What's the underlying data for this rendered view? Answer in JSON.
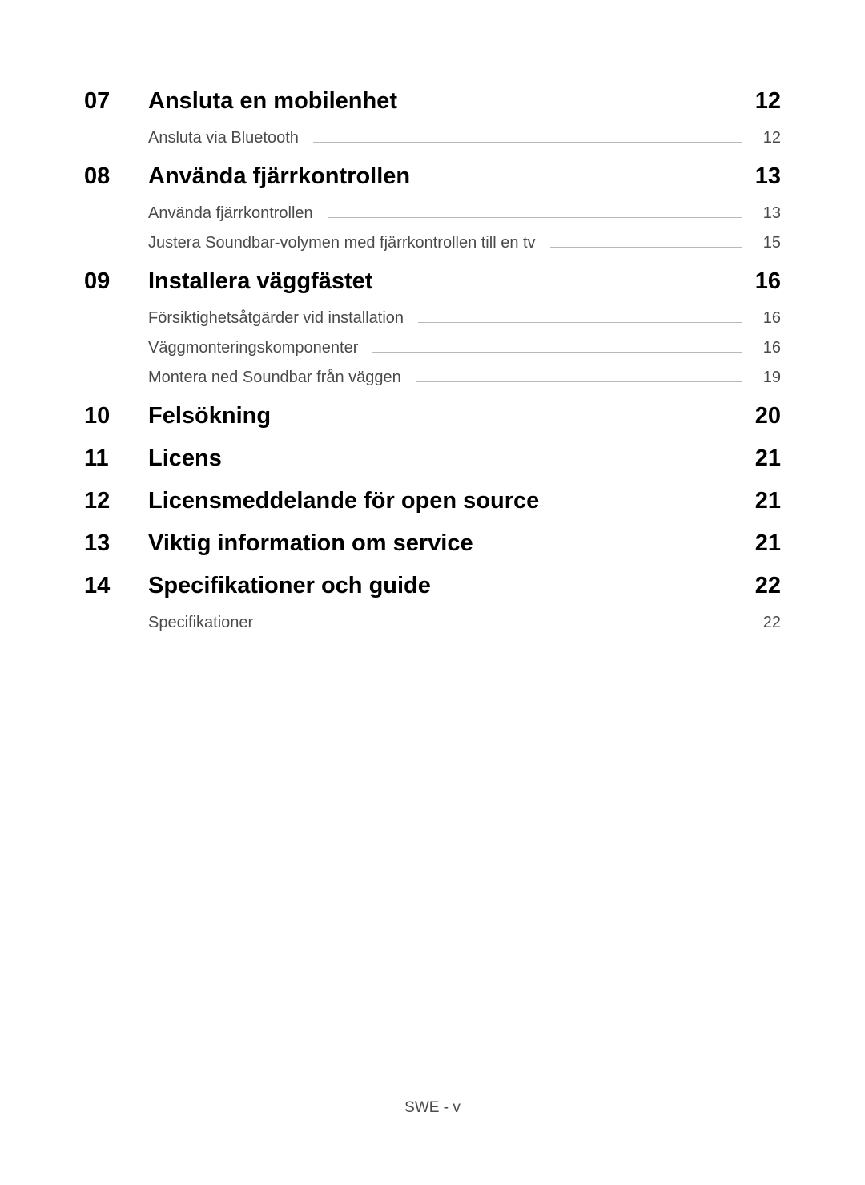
{
  "toc": [
    {
      "number": "07",
      "title": "Ansluta en mobilenhet",
      "page": "12",
      "subitems": [
        {
          "title": "Ansluta via Bluetooth",
          "page": "12"
        }
      ]
    },
    {
      "number": "08",
      "title": "Använda fjärrkontrollen",
      "page": "13",
      "subitems": [
        {
          "title": "Använda fjärrkontrollen",
          "page": "13"
        },
        {
          "title": "Justera Soundbar-volymen med fjärrkontrollen till en tv",
          "page": "15"
        }
      ]
    },
    {
      "number": "09",
      "title": "Installera väggfästet",
      "page": "16",
      "subitems": [
        {
          "title": "Försiktighetsåtgärder vid installation",
          "page": "16"
        },
        {
          "title": "Väggmonteringskomponenter",
          "page": "16"
        },
        {
          "title": "Montera ned Soundbar från väggen",
          "page": "19"
        }
      ]
    },
    {
      "number": "10",
      "title": "Felsökning",
      "page": "20",
      "subitems": []
    },
    {
      "number": "11",
      "title": "Licens",
      "page": "21",
      "subitems": []
    },
    {
      "number": "12",
      "title": "Licensmeddelande för open source",
      "page": "21",
      "subitems": []
    },
    {
      "number": "13",
      "title": "Viktig information om service",
      "page": "21",
      "subitems": []
    },
    {
      "number": "14",
      "title": "Specifikationer och guide",
      "page": "22",
      "subitems": [
        {
          "title": "Specifikationer",
          "page": "22"
        }
      ]
    }
  ],
  "footer": "SWE - v"
}
